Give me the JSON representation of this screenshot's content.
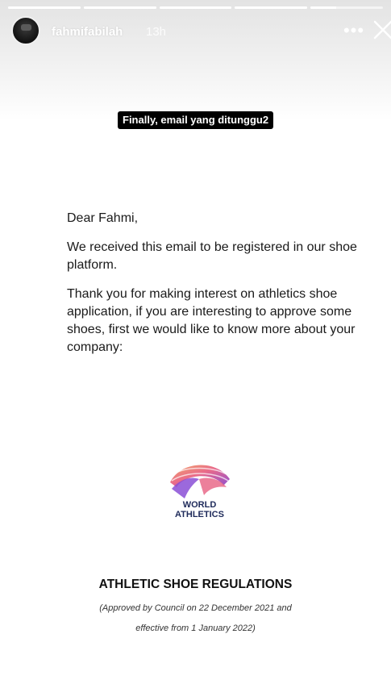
{
  "header": {
    "username": "fahmifabilah",
    "time": "13h",
    "more_icon": "more-horizontal-icon",
    "close_icon": "close-icon",
    "progress_segments": [
      1,
      1,
      1,
      1,
      0.35
    ]
  },
  "caption": "Finally, email yang ditunggu2",
  "letter": {
    "greeting": "Dear Fahmi,",
    "paragraph1": "We received this email to be registered in our shoe platform.",
    "paragraph2": "Thank you for making interest on athletics shoe application, if you are interesting to approve some shoes, first we would like to know more about your company:"
  },
  "logo": {
    "line1": "WORLD",
    "line2": "ATHLETICS"
  },
  "regulations": {
    "title": "ATHLETIC SHOE REGULATIONS",
    "note_line1": "(Approved by Council on 22 December 2021 and",
    "note_line2": "effective from 1 January 2022)"
  }
}
